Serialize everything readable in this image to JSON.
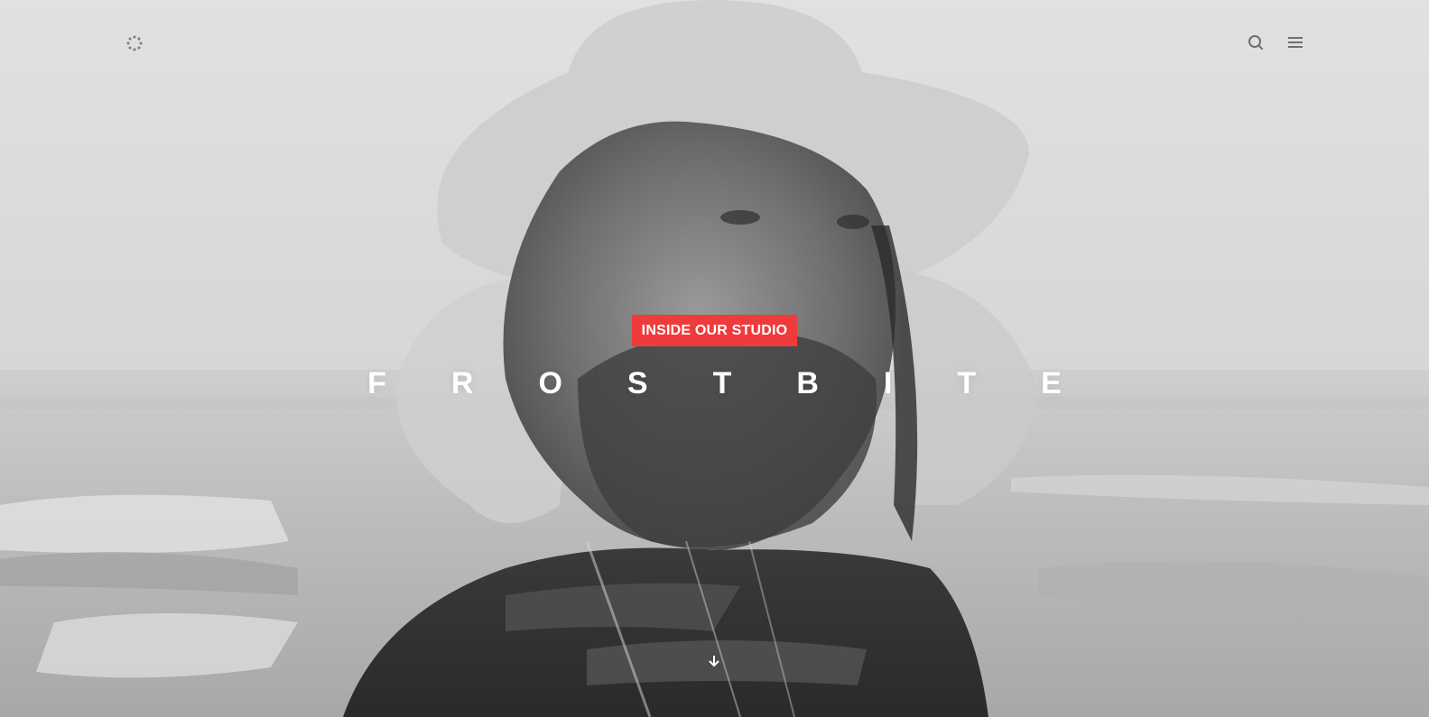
{
  "hero": {
    "tag_label": "INSIDE OUR STUDIO",
    "title": "FROSTBITE"
  },
  "header": {
    "logo_icon": "dotted-circle-logo-icon",
    "search_icon": "search-icon",
    "menu_icon": "hamburger-menu-icon"
  },
  "scroll": {
    "icon": "arrow-down-icon"
  },
  "colors": {
    "accent": "#ef3b3b",
    "title_text": "#ffffff",
    "icon": "#6f6f6f"
  }
}
